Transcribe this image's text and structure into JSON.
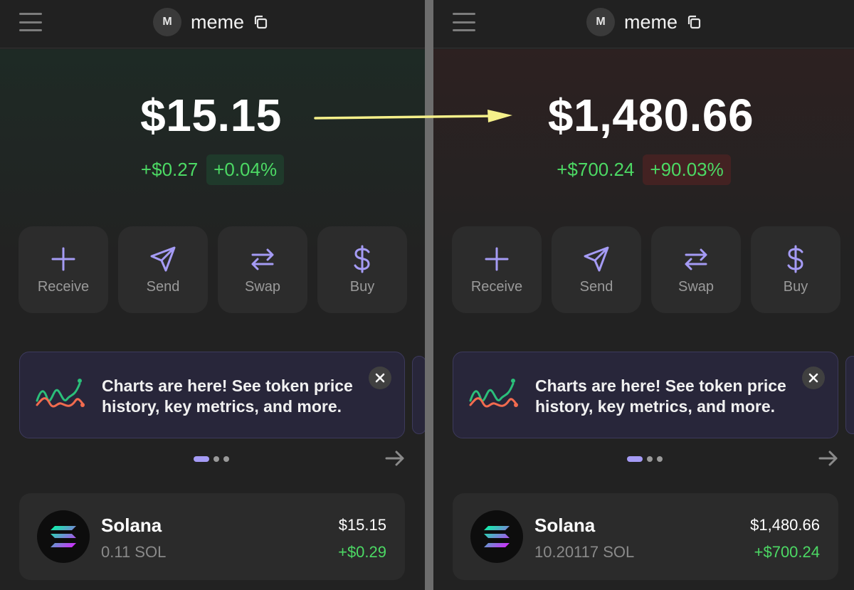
{
  "panels": [
    {
      "account": {
        "avatar_letter": "M",
        "name": "meme"
      },
      "balance": "$15.15",
      "change_abs": "+$0.27",
      "change_pct": "+0.04%",
      "actions": [
        {
          "label": "Receive",
          "icon": "plus-icon"
        },
        {
          "label": "Send",
          "icon": "send-icon"
        },
        {
          "label": "Swap",
          "icon": "swap-icon"
        },
        {
          "label": "Buy",
          "icon": "dollar-icon"
        }
      ],
      "banner": {
        "text": "Charts are here! See token price history, key metrics, and more."
      },
      "carousel": {
        "active_index": 0,
        "count": 3
      },
      "token": {
        "name": "Solana",
        "amount": "0.11 SOL",
        "value": "$15.15",
        "change": "+$0.29"
      }
    },
    {
      "account": {
        "avatar_letter": "M",
        "name": "meme"
      },
      "balance": "$1,480.66",
      "change_abs": "+$700.24",
      "change_pct": "+90.03%",
      "actions": [
        {
          "label": "Receive",
          "icon": "plus-icon"
        },
        {
          "label": "Send",
          "icon": "send-icon"
        },
        {
          "label": "Swap",
          "icon": "swap-icon"
        },
        {
          "label": "Buy",
          "icon": "dollar-icon"
        }
      ],
      "banner": {
        "text": "Charts are here! See token price history, key metrics, and more."
      },
      "carousel": {
        "active_index": 0,
        "count": 3
      },
      "token": {
        "name": "Solana",
        "amount": "10.20117 SOL",
        "value": "$1,480.66",
        "change": "+$700.24"
      }
    }
  ],
  "colors": {
    "accent": "#a59bf5",
    "positive": "#4cd964",
    "annotation_arrow": "#f5f08a"
  }
}
